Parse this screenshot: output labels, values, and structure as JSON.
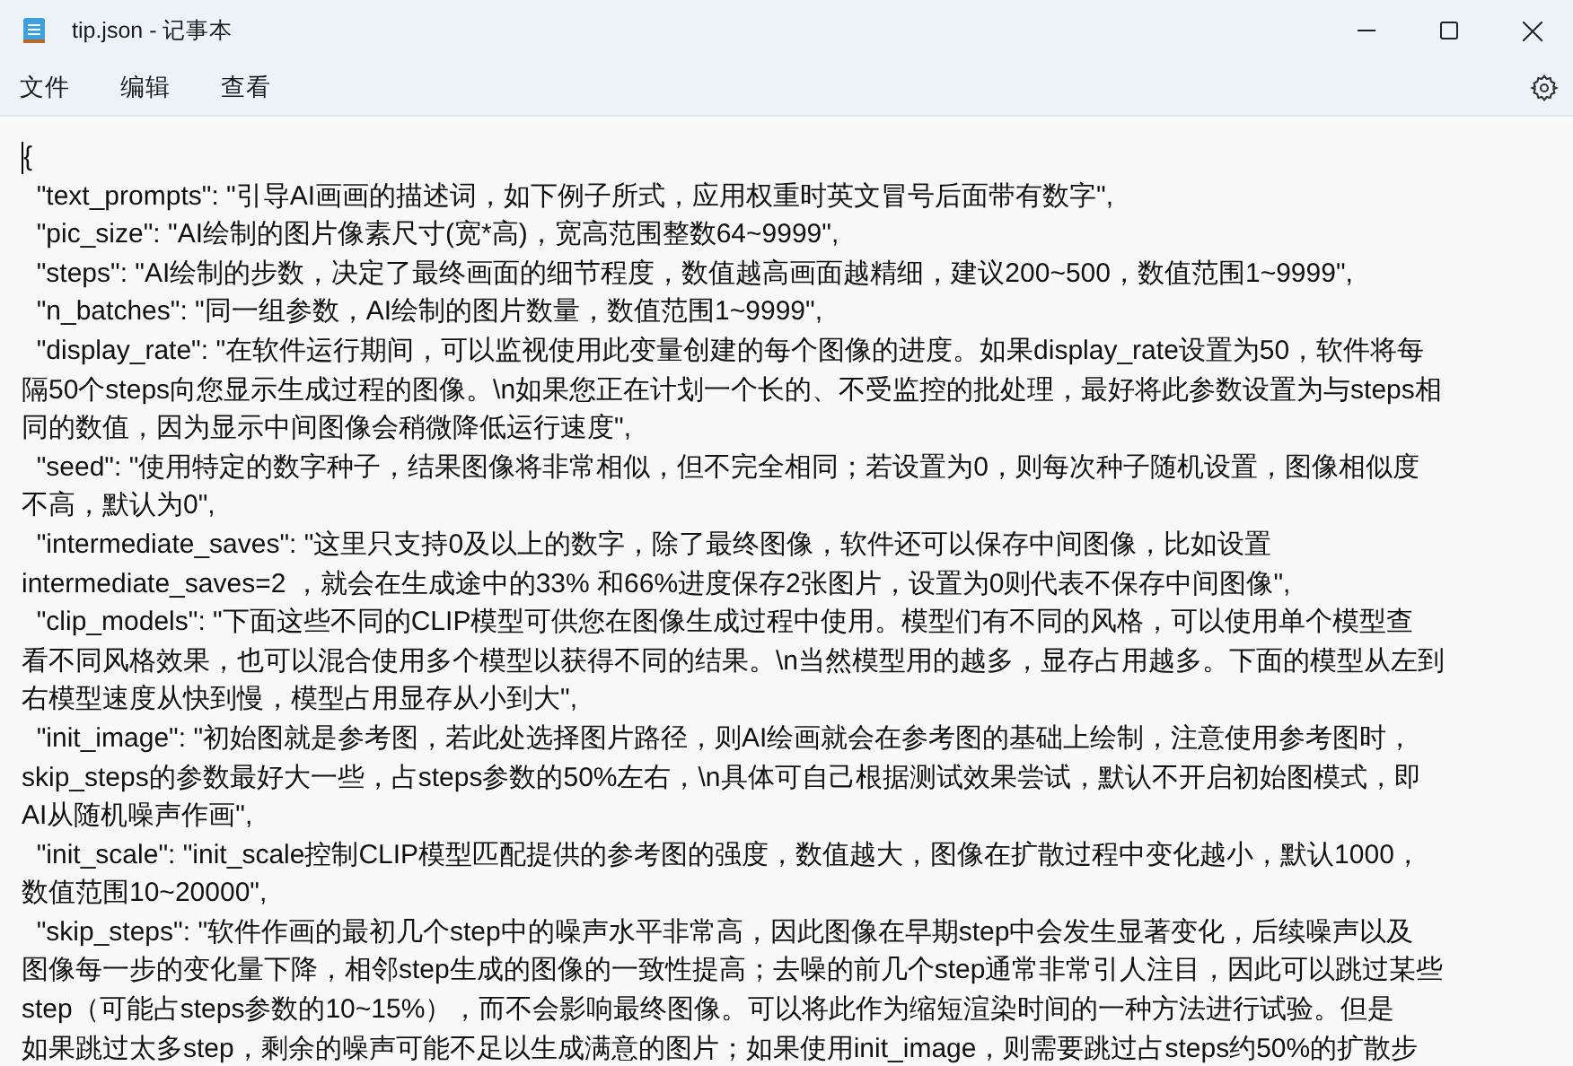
{
  "window": {
    "title": "tip.json - 记事本"
  },
  "menu": [
    {
      "label": "文件"
    },
    {
      "label": "编辑"
    },
    {
      "label": "查看"
    }
  ],
  "editor": {
    "lines": [
      "{",
      "  \"text_prompts\": \"引导AI画画的描述词，如下例子所式，应用权重时英文冒号后面带有数字\",",
      "  \"pic_size\": \"AI绘制的图片像素尺寸(宽*高)，宽高范围整数64~9999\",",
      "  \"steps\": \"AI绘制的步数，决定了最终画面的细节程度，数值越高画面越精细，建议200~500，数值范围1~9999\",",
      "  \"n_batches\": \"同一组参数，AI绘制的图片数量，数值范围1~9999\",",
      "  \"display_rate\": \"在软件运行期间，可以监视使用此变量创建的每个图像的进度。如果display_rate设置为50，软件将每",
      "隔50个steps向您显示生成过程的图像。\\n如果您正在计划一个长的、不受监控的批处理，最好将此参数设置为与steps相",
      "同的数值，因为显示中间图像会稍微降低运行速度\",",
      "  \"seed\": \"使用特定的数字种子，结果图像将非常相似，但不完全相同；若设置为0，则每次种子随机设置，图像相似度",
      "不高，默认为0\",",
      "  \"intermediate_saves\": \"这里只支持0及以上的数字，除了最终图像，软件还可以保存中间图像，比如设置",
      "intermediate_saves=2 ，就会在生成途中的33% 和66%进度保存2张图片，设置为0则代表不保存中间图像\",",
      "  \"clip_models\": \"下面这些不同的CLIP模型可供您在图像生成过程中使用。模型们有不同的风格，可以使用单个模型查",
      "看不同风格效果，也可以混合使用多个模型以获得不同的结果。\\n当然模型用的越多，显存占用越多。下面的模型从左到",
      "右模型速度从快到慢，模型占用显存从小到大\",",
      "  \"init_image\": \"初始图就是参考图，若此处选择图片路径，则AI绘画就会在参考图的基础上绘制，注意使用参考图时，",
      "skip_steps的参数最好大一些，占steps参数的50%左右，\\n具体可自己根据测试效果尝试，默认不开启初始图模式，即",
      "AI从随机噪声作画\",",
      "  \"init_scale\": \"init_scale控制CLIP模型匹配提供的参考图的强度，数值越大，图像在扩散过程中变化越小，默认1000，",
      "数值范围10~20000\",",
      "  \"skip_steps\": \"软件作画的最初几个step中的噪声水平非常高，因此图像在早期step中会发生显著变化，后续噪声以及",
      "图像每一步的变化量下降，相邻step生成的图像的一致性提高；去噪的前几个step通常非常引人注目，因此可以跳过某些",
      "step（可能占steps参数的10~15%），而不会影响最终图像。可以将此作为缩短渲染时间的一种方法进行试验。但是",
      "如果跳过太多step，剩余的噪声可能不足以生成满意的图片；如果使用init_image，则需要跳过占steps约50%的扩散步"
    ]
  }
}
